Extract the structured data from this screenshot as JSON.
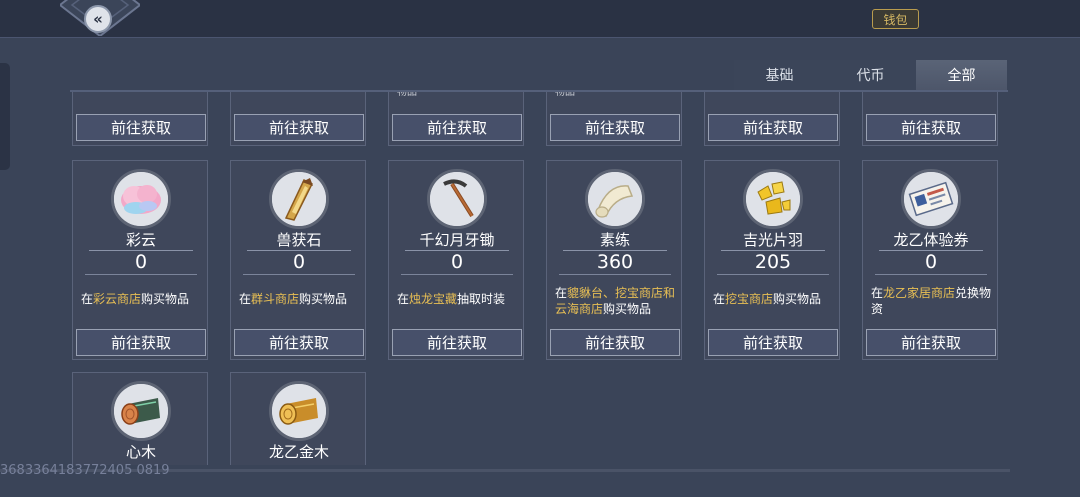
{
  "header": {
    "back_icon": "chevron-left-icon",
    "wallet_label": "钱包"
  },
  "tabs": [
    {
      "label": "基础",
      "active": false
    },
    {
      "label": "代币",
      "active": false
    },
    {
      "label": "全部",
      "active": true
    }
  ],
  "top_row": {
    "go_label": "前往获取",
    "cut_text_3": "物品",
    "cut_text_4": "物品"
  },
  "items": [
    {
      "name": "彩云",
      "count": "0",
      "icon": "pink-cloud-icon",
      "desc_pre": "在",
      "desc_hl": "彩云商店",
      "desc_post": "购买物品",
      "go_label": "前往获取"
    },
    {
      "name": "兽获石",
      "count": "0",
      "icon": "golden-fang-stone-icon",
      "desc_pre": "在",
      "desc_hl": "群斗商店",
      "desc_post": "购买物品",
      "go_label": "前往获取"
    },
    {
      "name": "千幻月牙锄",
      "count": "0",
      "icon": "pickaxe-icon",
      "desc_pre": "在",
      "desc_hl": "烛龙宝藏",
      "desc_post": "抽取时装",
      "go_label": "前往获取"
    },
    {
      "name": "素练",
      "count": "360",
      "icon": "cloth-roll-icon",
      "desc_pre": "在",
      "desc_hl": "貔貅台、挖宝商店和云海商店",
      "desc_post": "购买物品",
      "go_label": "前往获取"
    },
    {
      "name": "吉光片羽",
      "count": "205",
      "icon": "gold-fragments-icon",
      "desc_pre": "在",
      "desc_hl": "挖宝商店",
      "desc_post": "购买物品",
      "go_label": "前往获取"
    },
    {
      "name": "龙乙体验券",
      "count": "0",
      "icon": "ticket-icon",
      "desc_pre": "在",
      "desc_hl": "龙乙家居商店",
      "desc_post": "兑换物资",
      "go_label": "前往获取"
    },
    {
      "name": "心木",
      "icon": "heart-wood-log-icon"
    },
    {
      "name": "龙乙金木",
      "icon": "golden-wood-log-icon"
    }
  ],
  "footer": {
    "uid": "3683364183772405 0819"
  }
}
